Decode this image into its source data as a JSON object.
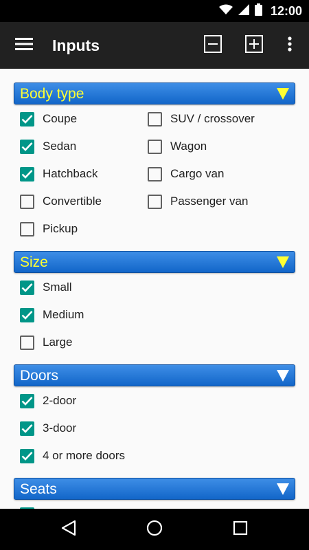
{
  "status_bar": {
    "time": "12:00"
  },
  "app_bar": {
    "title": "Inputs"
  },
  "colors": {
    "accent": "#009688",
    "header_blue": "#1E78D8",
    "header_text_yellow": "#FFFF33",
    "header_text_white": "#FFFFFF",
    "app_bar": "#212121"
  },
  "icons": {
    "menu": "hamburger-icon",
    "collapse": "minus-square-icon",
    "expand": "plus-square-icon",
    "overflow": "more-vert-icon",
    "back": "back-triangle-icon",
    "home": "home-circle-icon",
    "recents": "recents-square-icon"
  },
  "sections": [
    {
      "title": "Body type",
      "highlight": true,
      "options": [
        {
          "label": "Coupe",
          "checked": true
        },
        {
          "label": "Sedan",
          "checked": true
        },
        {
          "label": "Hatchback",
          "checked": true
        },
        {
          "label": "Convertible",
          "checked": false
        },
        {
          "label": "Pickup",
          "checked": false
        },
        {
          "label": "SUV / crossover",
          "checked": false
        },
        {
          "label": "Wagon",
          "checked": false
        },
        {
          "label": "Cargo van",
          "checked": false
        },
        {
          "label": "Passenger van",
          "checked": false
        }
      ]
    },
    {
      "title": "Size",
      "highlight": true,
      "options": [
        {
          "label": "Small",
          "checked": true
        },
        {
          "label": "Medium",
          "checked": true
        },
        {
          "label": "Large",
          "checked": false
        }
      ]
    },
    {
      "title": "Doors",
      "highlight": false,
      "options": [
        {
          "label": "2-door",
          "checked": true
        },
        {
          "label": "3-door",
          "checked": true
        },
        {
          "label": "4 or more doors",
          "checked": true
        }
      ]
    },
    {
      "title": "Seats",
      "highlight": false,
      "options": [
        {
          "label": "",
          "checked": true
        }
      ]
    }
  ]
}
